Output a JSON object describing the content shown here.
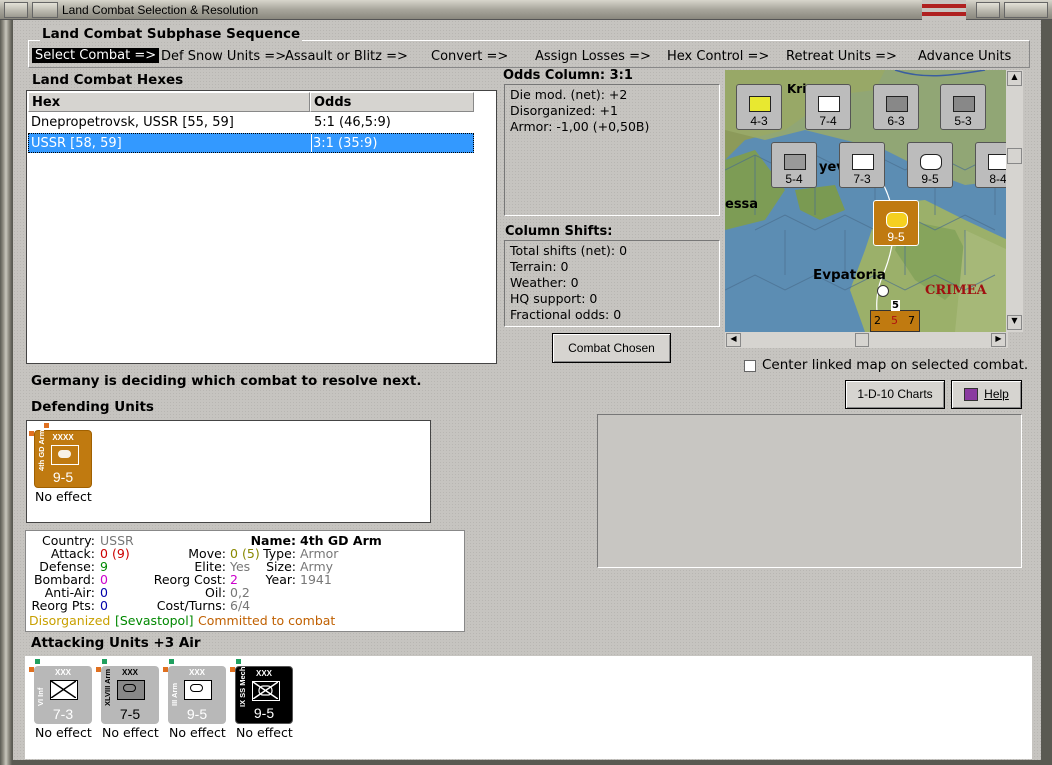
{
  "window": {
    "title": "Land Combat Selection & Resolution"
  },
  "subphase": {
    "heading": "Land Combat Subphase Sequence",
    "steps": [
      "Select Combat =>",
      "Def Snow Units =>",
      "Assault or Blitz =>",
      "Convert =>",
      "Assign Losses =>",
      "Hex Control =>",
      "Retreat Units =>",
      "Advance Units"
    ]
  },
  "hexes": {
    "heading": "Land Combat Hexes",
    "columns": [
      "Hex",
      "Odds"
    ],
    "rows": [
      {
        "hex": "Dnepropetrovsk, USSR [55, 59]",
        "odds": "5:1 (46,5:9)"
      },
      {
        "hex": "USSR [58, 59]",
        "odds": "3:1 (35:9)",
        "selected": true
      }
    ]
  },
  "odds": {
    "heading": "Odds Column: 3:1",
    "lines": [
      "Die mod. (net): +2",
      "Disorganized: +1",
      "Armor: -1,00 (+0,50B)"
    ]
  },
  "shifts": {
    "heading": "Column Shifts:",
    "lines": [
      "Total shifts (net): 0",
      "Terrain: 0",
      "Weather: 0",
      "HQ support: 0",
      "Fractional odds: 0"
    ]
  },
  "buttons": {
    "combat_chosen": "Combat Chosen",
    "charts": "1-D-10 Charts",
    "help": "Help"
  },
  "center_map_label": "Center linked map on selected combat.",
  "status_message": "Germany is deciding which combat to resolve next.",
  "defending": {
    "heading": "Defending Units",
    "units": [
      {
        "size": "XXXX",
        "name": "4th GD Arm",
        "value": "9-5",
        "result": "No effect",
        "color": "#c07a10"
      }
    ]
  },
  "details": {
    "country_label": "Country:",
    "country": "USSR",
    "attack_label": "Attack:",
    "attack": "0",
    "attack_paren": "(9)",
    "defense_label": "Defense:",
    "defense": "9",
    "bombard_label": "Bombard:",
    "bombard": "0",
    "antiair_label": "Anti-Air:",
    "antiair": "0",
    "reorgpts_label": "Reorg Pts:",
    "reorgpts": "0",
    "name_label": "Name:",
    "name": "4th GD Arm",
    "move_label": "Move:",
    "move": "0",
    "move_paren": "(5)",
    "elite_label": "Elite:",
    "elite": "Yes",
    "reorgcost_label": "Reorg Cost:",
    "reorgcost": "2",
    "oil_label": "Oil:",
    "oil": "0,2",
    "costturns_label": "Cost/Turns:",
    "costturns": "6/4",
    "type_label": "Type:",
    "type": "Armor",
    "size_label": "Size:",
    "size": "Army",
    "year_label": "Year:",
    "year": "1941",
    "status_disorganized": "Disorganized",
    "status_location": "[Sevastopol]",
    "status_committed": "Committed to combat"
  },
  "attacking": {
    "heading": "Attacking Units +3 Air",
    "units": [
      {
        "size": "XXX",
        "name": "VI Inf",
        "value": "7-3",
        "result": "No effect",
        "color": "#b8b8b8"
      },
      {
        "size": "XXX",
        "name": "XLVIII Arm",
        "value": "7-5",
        "result": "No effect",
        "color": "#b8b8b8"
      },
      {
        "size": "XXX",
        "name": "III Arm",
        "value": "9-5",
        "result": "No effect",
        "color": "#b8b8b8"
      },
      {
        "size": "XXX",
        "name": "IX SS Mech",
        "value": "9-5",
        "result": "No effect",
        "color": "#000000"
      }
    ]
  },
  "map": {
    "labels": [
      "essa",
      "Evpatoria",
      "CRIMEA",
      "Kri",
      "yev"
    ],
    "counters": [
      {
        "value": "4-3"
      },
      {
        "value": "7-4"
      },
      {
        "value": "6-3"
      },
      {
        "value": "5-3"
      },
      {
        "value": "5-4"
      },
      {
        "value": "7-3"
      },
      {
        "value": "9-5"
      },
      {
        "value": "8-4"
      },
      {
        "value": "9-5"
      }
    ],
    "stack_values": [
      "2",
      "5",
      "7"
    ],
    "stack_top": "5"
  }
}
